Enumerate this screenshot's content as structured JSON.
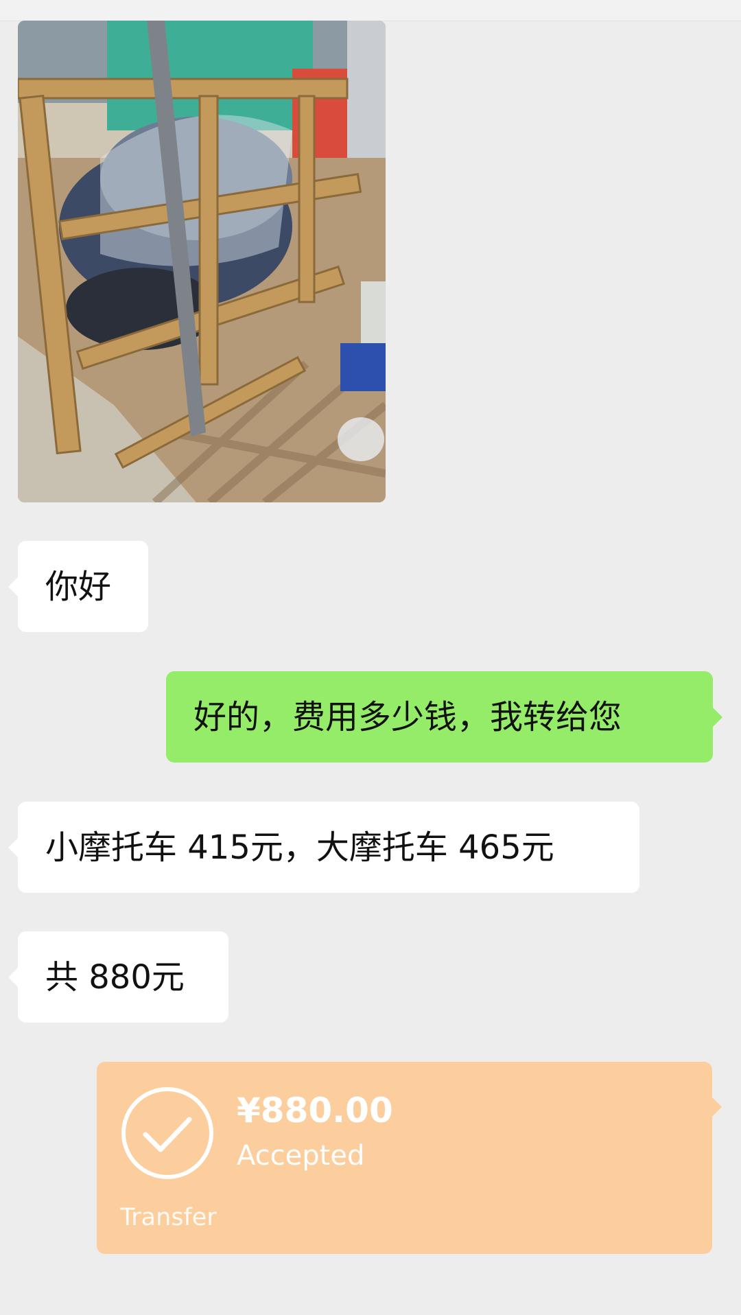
{
  "messages": {
    "hello": "你好",
    "reply": "好的，费用多少钱，我转给您",
    "prices": "小摩托车 415元，大摩托车 465元",
    "total": "共 880元"
  },
  "transfer": {
    "amount": "¥880.00",
    "status": "Accepted",
    "label": "Transfer"
  },
  "colors": {
    "background": "#ededed",
    "incoming_bubble": "#ffffff",
    "outgoing_bubble": "#95ec69",
    "transfer_card": "#fcce9d"
  },
  "icons": {
    "transfer_status": "checkmark-circle-icon"
  }
}
